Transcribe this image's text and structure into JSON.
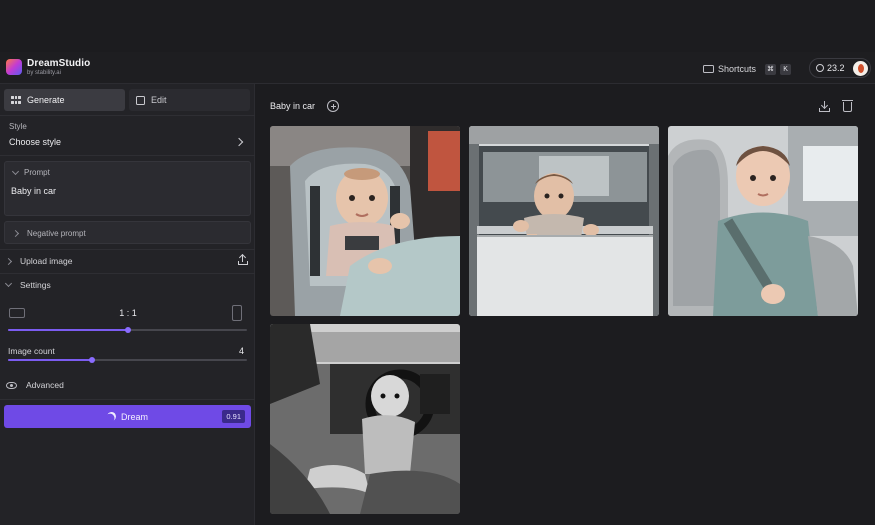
{
  "app": {
    "name": "DreamStudio",
    "subtitle": "by stability.ai"
  },
  "header": {
    "shortcuts_label": "Shortcuts",
    "shortcut_keys": [
      "⌘",
      "K"
    ],
    "credits": "23.2"
  },
  "tabs": {
    "generate_label": "Generate",
    "edit_label": "Edit"
  },
  "style": {
    "label": "Style",
    "value": "Choose style"
  },
  "prompt": {
    "label": "Prompt",
    "text": "Baby in car"
  },
  "negative_prompt": {
    "label": "Negative prompt"
  },
  "upload_image": {
    "label": "Upload image"
  },
  "settings": {
    "label": "Settings",
    "aspect_ratio": "1 : 1",
    "aspect_ratio_slider_value": 0.5,
    "image_count_label": "Image count",
    "image_count": "4",
    "image_count_slider_value": 0.35,
    "advanced_label": "Advanced"
  },
  "dream_button": {
    "label": "Dream",
    "cost": "0.91"
  },
  "gallery": {
    "title": "Baby in car",
    "images": [
      {
        "subject": "baby in grey car seat"
      },
      {
        "subject": "baby looking out car window"
      },
      {
        "subject": "baby in teal jacket in car seat"
      },
      {
        "subject": "black and white baby in driver seat"
      }
    ]
  },
  "colors": {
    "accent": "#6f4ae6",
    "background": "#1c1c1f",
    "sidebar": "#232327"
  }
}
